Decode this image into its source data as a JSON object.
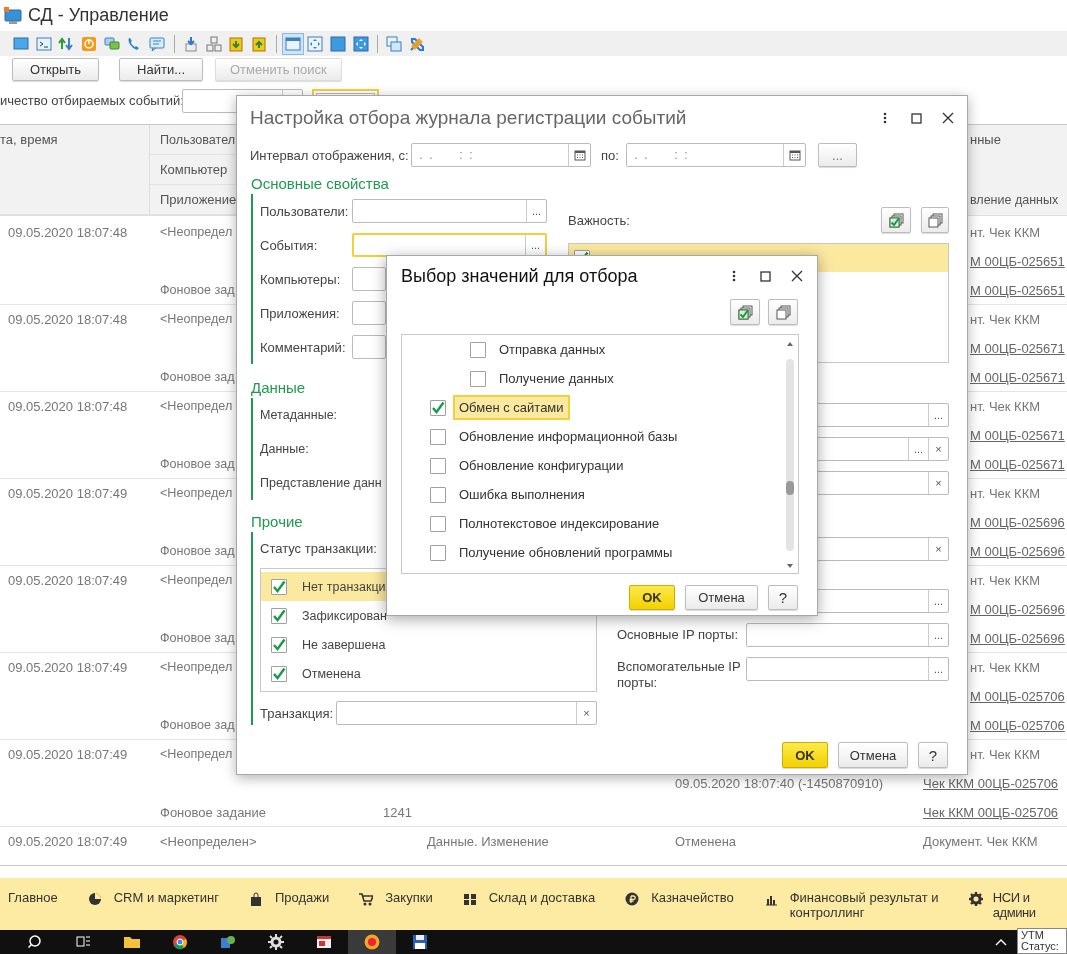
{
  "window": {
    "title": "СД - Управление"
  },
  "toolbar": [
    {
      "selected": false
    },
    {
      "selected": false
    },
    {
      "selected": false
    },
    {
      "selected": false
    },
    {
      "selected": false
    },
    {
      "selected": false
    },
    {
      "selected": false
    },
    {
      "selected": false
    },
    {
      "selected": false
    },
    {
      "selected": false
    },
    {
      "selected": false
    },
    {
      "selected": true
    },
    {
      "selected": false
    },
    {
      "selected": false
    },
    {
      "selected": false
    },
    {
      "selected": false
    },
    {
      "selected": false
    }
  ],
  "commands": [
    {
      "label": "Открыть",
      "disabled": false
    },
    {
      "label": "Найти...",
      "disabled": false
    },
    {
      "label": "Отменить поиск",
      "disabled": true
    }
  ],
  "filter": {
    "label": "ичество отбираемых событий:",
    "period_focused": true
  },
  "journal": {
    "header": {
      "date": "та, время",
      "user": "Пользовател",
      "computer": "Компьютер",
      "application": "Приложение",
      "data": "нные",
      "data_presentation": "вление данных"
    },
    "rows": [
      {
        "date": "09.05.2020 18:07:48",
        "user": "<Неопредел",
        "application": "Фоновое зад",
        "data": "нт. Чек ККМ",
        "links": [
          "М 00ЦБ-025651",
          "М 00ЦБ-025651"
        ]
      },
      {
        "date": "09.05.2020 18:07:48",
        "user": "<Неопредел",
        "application": "Фоновое зад",
        "data": "нт. Чек ККМ",
        "links": [
          "М 00ЦБ-025671",
          "М 00ЦБ-025671"
        ]
      },
      {
        "date": "09.05.2020 18:07:48",
        "user": "<Неопредел",
        "application": "Фоновое зад",
        "data": "нт. Чек ККМ",
        "links": [
          "М 00ЦБ-025671",
          "М 00ЦБ-025671"
        ]
      },
      {
        "date": "09.05.2020 18:07:49",
        "user": "<Неопредел",
        "application": "Фоновое зад",
        "data": "нт. Чек ККМ",
        "links": [
          "М 00ЦБ-025696",
          "М 00ЦБ-025696"
        ]
      },
      {
        "date": "09.05.2020 18:07:49",
        "user": "<Неопредел",
        "application": "Фоновое зад",
        "data": "нт. Чек ККМ",
        "links": [
          "М 00ЦБ-025696",
          "М 00ЦБ-025696"
        ]
      },
      {
        "date": "09.05.2020 18:07:49",
        "user": "<Неопредел",
        "application": "Фоновое зад",
        "data": "нт. Чек ККМ",
        "links": [
          "М 00ЦБ-025706",
          "М 00ЦБ-025706"
        ]
      },
      {
        "date": "09.05.2020 18:07:49",
        "user": "<Неопредел",
        "application": "Фоновое задание",
        "session": "1241",
        "transaction": "09.05.2020 18:07:40 (-1450870910)",
        "data": "нт. Чек ККМ",
        "links": [
          "Чек ККМ 00ЦБ-025706",
          "Чек ККМ 00ЦБ-025706"
        ]
      },
      {
        "date": "09.05.2020 18:07:49",
        "user": "<Неопределен>",
        "event": "Данные. Изменение",
        "status": "Отменена",
        "data": "Документ. Чек ККМ"
      }
    ]
  },
  "settings_dialog": {
    "title": "Настройка отбора журнала регистрации событий",
    "interval_label": "Интервал отображения, с:",
    "from": " .  .        :  :",
    "to_label": "по:",
    "to": " .  .        :  :",
    "more_button": "...",
    "main_section": {
      "title": "Основные свойства",
      "fields": [
        {
          "label": "Пользователи:",
          "focused": false,
          "select": "..."
        },
        {
          "label": "События:",
          "focused": true,
          "select": "..."
        },
        {
          "label": "Компьютеры:",
          "focused": false
        },
        {
          "label": "Приложения:",
          "focused": false
        },
        {
          "label": "Комментарий:",
          "focused": false
        }
      ]
    },
    "data_section": {
      "title": "Данные",
      "fields": [
        {
          "label": "Метаданные:",
          "select": "..."
        },
        {
          "label": "Данные:",
          "select": "...",
          "clear": "×"
        },
        {
          "label": "Представление данн",
          "clear": "×"
        }
      ]
    },
    "other_section": {
      "title": "Прочие",
      "status_label": "Статус транзакции:",
      "statuses": [
        {
          "label": "Нет транзакци",
          "checked": true,
          "selected": true
        },
        {
          "label": "Зафиксирован",
          "checked": true,
          "selected": false
        },
        {
          "label": "Не завершена",
          "checked": true,
          "selected": false
        },
        {
          "label": "Отменена",
          "checked": true,
          "selected": false
        }
      ],
      "transaction": {
        "label": "Транзакция:",
        "clear": "×"
      }
    },
    "importance": {
      "label": "Важность:",
      "items": [
        {
          "checked": true,
          "selected": true
        }
      ]
    },
    "right_fields": [
      {
        "clear": "×"
      },
      {
        "select": "..."
      }
    ],
    "ip_fields": [
      {
        "label": "Основные IP порты:",
        "select": "..."
      },
      {
        "label": "Вспомогательные IP порты:",
        "select": "..."
      }
    ],
    "buttons": {
      "ok": "OK",
      "cancel": "Отмена",
      "help": "?"
    }
  },
  "choice_dialog": {
    "title": "Выбор значений для отбора",
    "items": [
      {
        "children": [
          {
            "label": "Отправка данных",
            "checked": false,
            "selected": false
          },
          {
            "label": "Получение данных",
            "checked": false,
            "selected": false
          }
        ]
      },
      {
        "label": "Обмен с сайтами",
        "checked": true,
        "selected": true
      },
      {
        "label": "Обновление информационной базы",
        "checked": false,
        "selected": false
      },
      {
        "label": "Обновление конфигурации",
        "checked": false,
        "selected": false
      },
      {
        "label": "Ошибка выполнения",
        "checked": false,
        "selected": false
      },
      {
        "label": "Полнотекстовое индексирование",
        "checked": false,
        "selected": false
      },
      {
        "label": "Получение обновлений программы",
        "checked": false,
        "selected": false
      }
    ],
    "buttons": {
      "ok": "OK",
      "cancel": "Отмена",
      "help": "?"
    }
  },
  "sections": [
    {
      "label": "Главное"
    },
    {
      "label": "CRM и маркетинг"
    },
    {
      "label": "Продажи"
    },
    {
      "label": "Закупки"
    },
    {
      "label": "Склад и доставка"
    },
    {
      "label": "Казначейство"
    },
    {
      "label": "Финансовый результат и контроллинг"
    },
    {
      "label": "НСИ и админи"
    }
  ],
  "tooltip": {
    "title": "УТМ",
    "status": "Статус:"
  }
}
